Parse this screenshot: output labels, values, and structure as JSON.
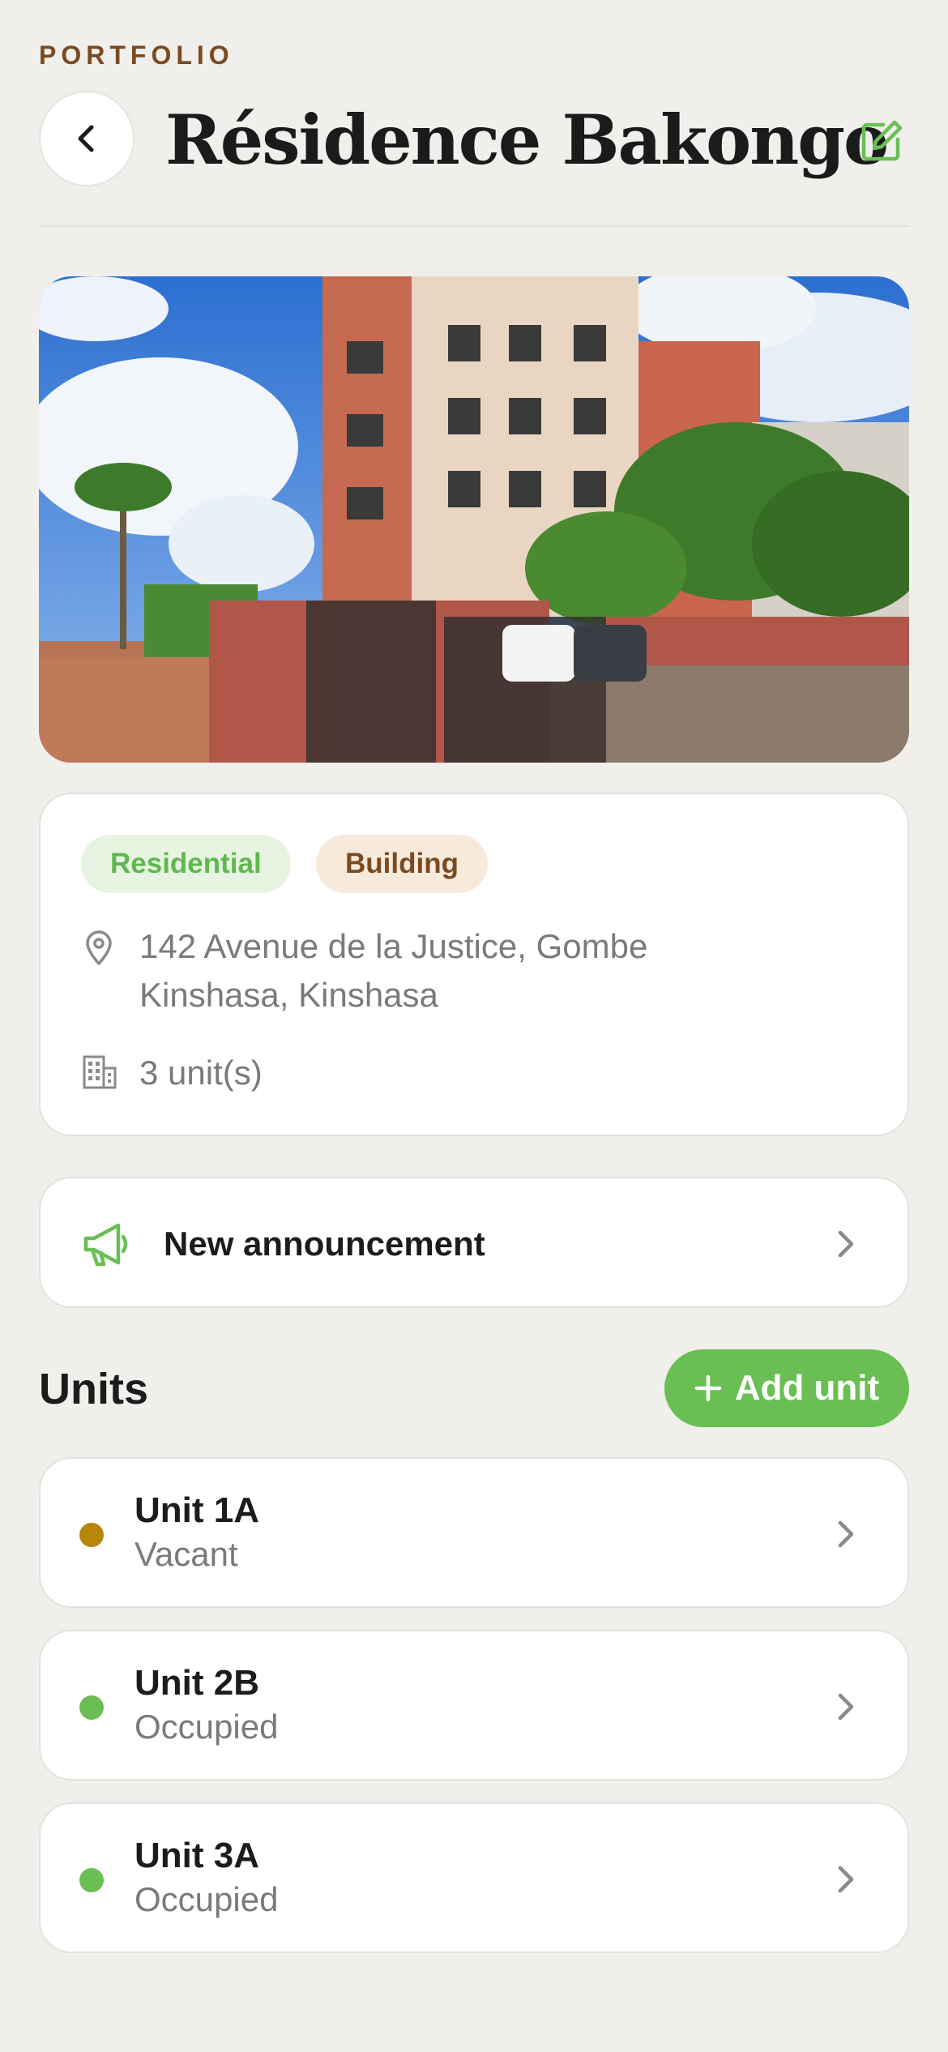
{
  "header": {
    "eyebrow": "PORTFOLIO",
    "title": "Résidence Bakongo",
    "back_icon": "chevron-left-icon",
    "edit_icon": "edit-icon",
    "accent_color": "#69bf53",
    "eyebrow_color": "#7a4a21"
  },
  "property": {
    "tags": [
      {
        "label": "Residential",
        "color": "#5fb84e"
      },
      {
        "label": "Building",
        "color": "#7a4a21"
      }
    ],
    "address_line1": "142 Avenue de la Justice, Gombe",
    "address_line2": "Kinshasa, Kinshasa",
    "unit_count": "3 unit(s)"
  },
  "announcement": {
    "label": "New announcement",
    "icon": "megaphone-icon"
  },
  "units_section": {
    "title": "Units",
    "add_label": "Add unit",
    "items": [
      {
        "name": "Unit 1A",
        "status": "Vacant",
        "status_color": "#b8860b"
      },
      {
        "name": "Unit 2B",
        "status": "Occupied",
        "status_color": "#69bf53"
      },
      {
        "name": "Unit 3A",
        "status": "Occupied",
        "status_color": "#69bf53"
      }
    ]
  }
}
